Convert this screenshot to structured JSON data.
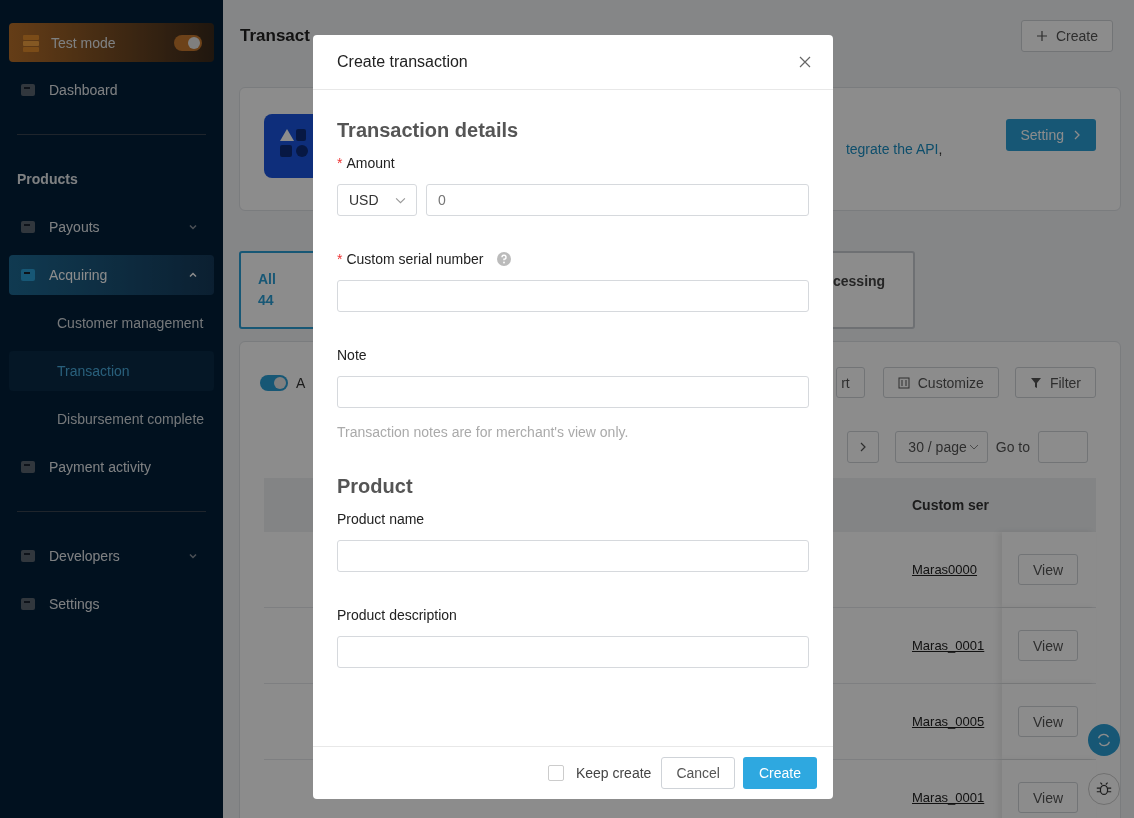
{
  "sidebar": {
    "test_mode": {
      "label": "Test mode",
      "on": true
    },
    "sections": [
      {
        "items": [
          {
            "label": "Dashboard",
            "selected": false
          }
        ]
      },
      {
        "heading": "Products",
        "items": [
          {
            "label": "Payouts",
            "selected": false,
            "expanded": false
          },
          {
            "label": "Acquiring",
            "selected": true,
            "expanded": true,
            "children": [
              {
                "label": "Customer management",
                "selected": false
              },
              {
                "label": "Transaction",
                "selected": true
              },
              {
                "label": "Disbursement complete",
                "selected": false
              }
            ]
          },
          {
            "label": "Payment activity",
            "selected": false
          }
        ]
      },
      {
        "items": [
          {
            "label": "Developers",
            "selected": false,
            "expanded": false
          },
          {
            "label": "Settings",
            "selected": false
          }
        ]
      }
    ]
  },
  "page": {
    "title": "Transact",
    "create_button": "Create"
  },
  "banner": {
    "link": "tegrate the API",
    "text": ",",
    "button": "Setting"
  },
  "status_tabs": [
    {
      "label": "All",
      "count": "44",
      "selected": true
    },
    {
      "label": "cessing",
      "selected": false
    }
  ],
  "table_card": {
    "toggle": {
      "label": "A",
      "on": true
    },
    "buttons": [
      {
        "kind": "export",
        "label": "rt"
      },
      {
        "kind": "customize",
        "label": "Customize"
      },
      {
        "kind": "filter",
        "label": "Filter"
      }
    ],
    "pagination": {
      "page_size": "30 / page",
      "goto_label": "Go to"
    },
    "columns": [
      "Custom ser"
    ],
    "rows": [
      {
        "serial": "Maras0000",
        "action": "View"
      },
      {
        "serial": "Maras_0001",
        "action": "View"
      },
      {
        "serial": "Maras_0005",
        "action": "View"
      },
      {
        "serial": "Maras_0001",
        "action": "View"
      }
    ]
  },
  "modal": {
    "title": "Create transaction",
    "sections": [
      {
        "heading": "Transaction details",
        "fields": [
          {
            "kind": "amount",
            "label": "Amount",
            "required_mark": "*",
            "currency": "USD",
            "placeholder": "0"
          },
          {
            "kind": "text",
            "label": "Custom serial number",
            "required_mark": "*",
            "help": true
          },
          {
            "kind": "text",
            "label": "Note",
            "hint": "Transaction notes are for merchant's view only."
          }
        ]
      },
      {
        "heading": "Product",
        "fields": [
          {
            "kind": "text",
            "label": "Product name"
          },
          {
            "kind": "text",
            "label": "Product description"
          }
        ]
      }
    ],
    "footer": {
      "keep_create": {
        "label": "Keep create",
        "checked": false
      },
      "cancel": "Cancel",
      "submit": "Create"
    }
  }
}
